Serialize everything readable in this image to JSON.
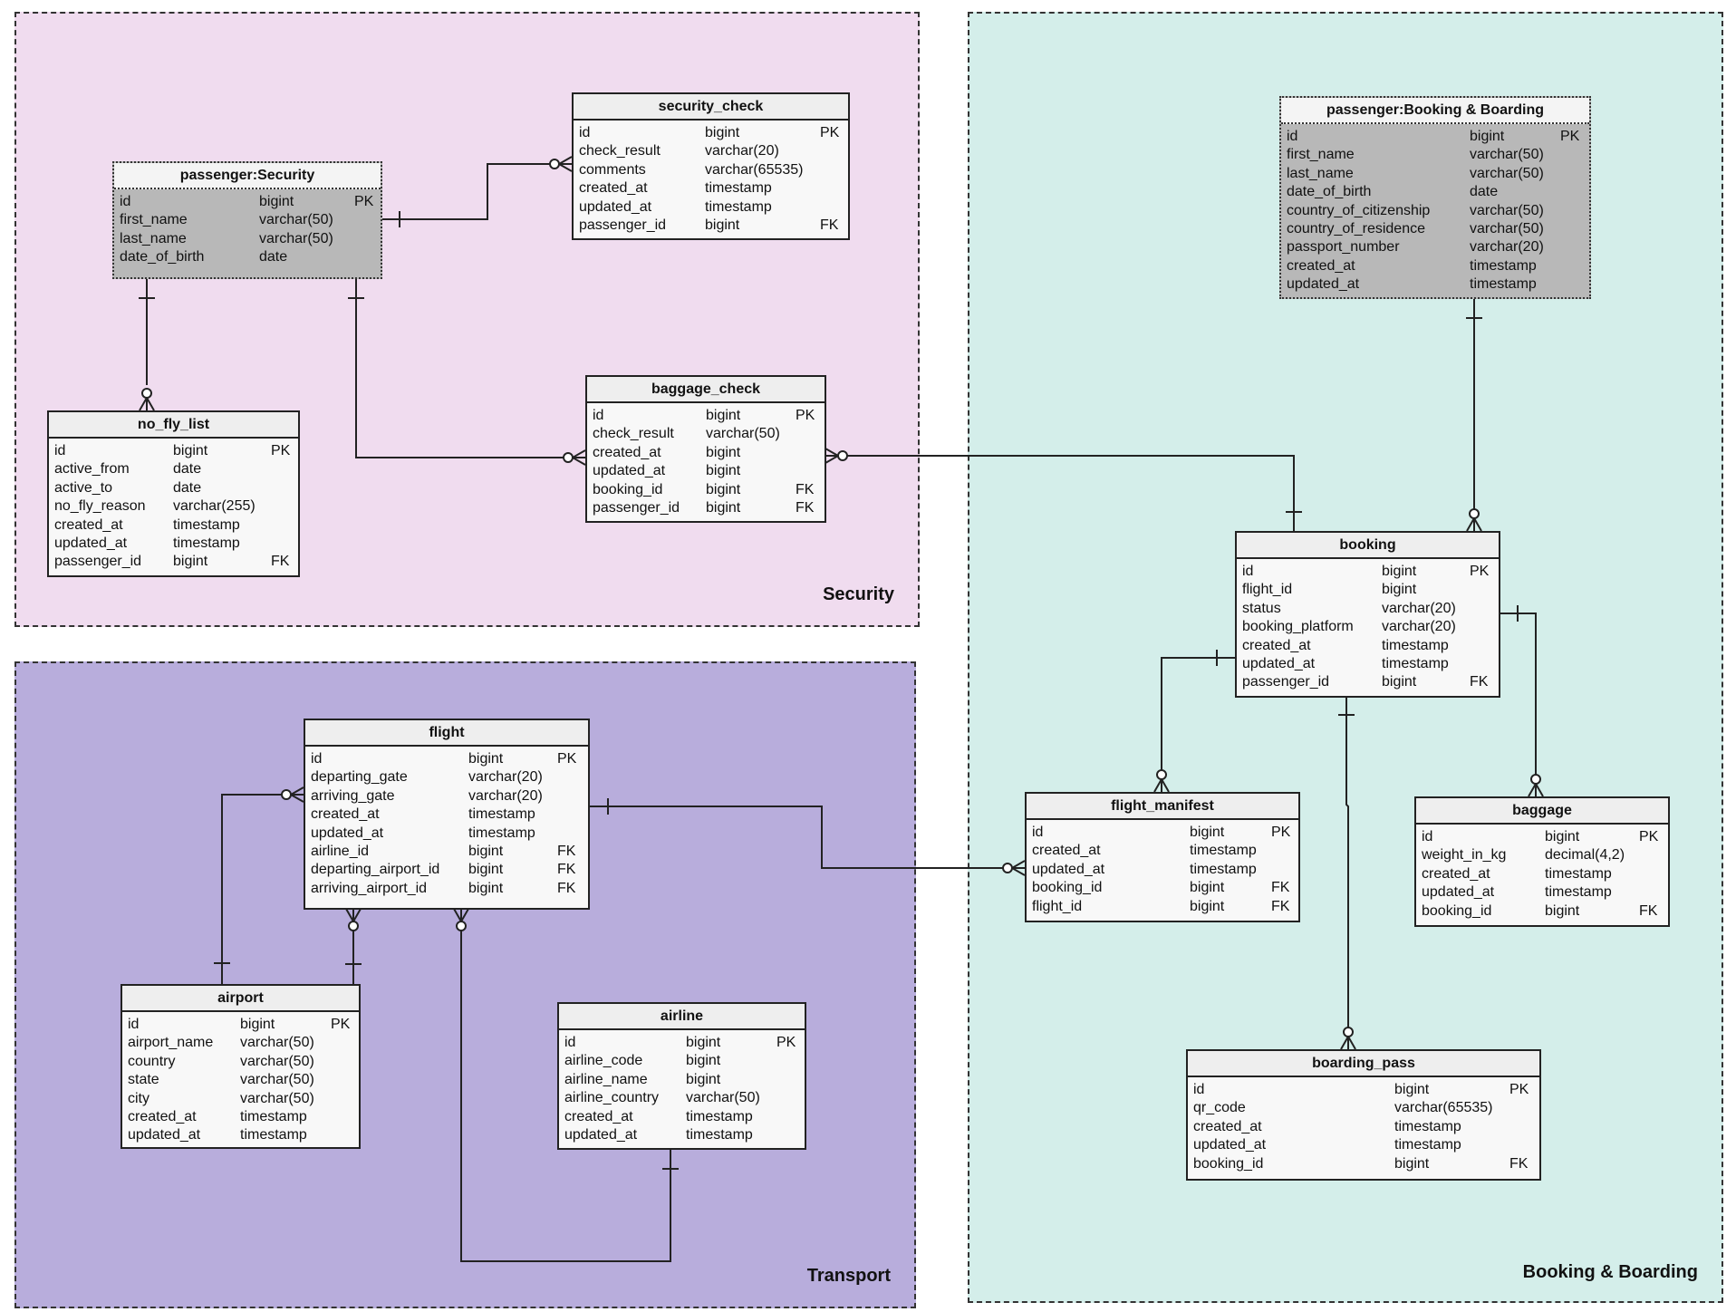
{
  "groups": {
    "security": {
      "label": "Security",
      "color": "#f0dcef"
    },
    "transport": {
      "label": "Transport",
      "color": "#b8addc"
    },
    "booking": {
      "label": "Booking & Boarding",
      "color": "#d4eeea"
    }
  },
  "tables": {
    "passenger_security": {
      "title": "passenger:Security",
      "columns": [
        [
          "id",
          "bigint",
          "PK"
        ],
        [
          "first_name",
          "varchar(50)",
          ""
        ],
        [
          "last_name",
          "varchar(50)",
          ""
        ],
        [
          "date_of_birth",
          "date",
          ""
        ]
      ]
    },
    "security_check": {
      "title": "security_check",
      "columns": [
        [
          "id",
          "bigint",
          "PK"
        ],
        [
          "check_result",
          "varchar(20)",
          ""
        ],
        [
          "comments",
          "varchar(65535)",
          ""
        ],
        [
          "created_at",
          "timestamp",
          ""
        ],
        [
          "updated_at",
          "timestamp",
          ""
        ],
        [
          "passenger_id",
          "bigint",
          "FK"
        ]
      ]
    },
    "no_fly_list": {
      "title": "no_fly_list",
      "columns": [
        [
          "id",
          "bigint",
          "PK"
        ],
        [
          "active_from",
          "date",
          ""
        ],
        [
          "active_to",
          "date",
          ""
        ],
        [
          "no_fly_reason",
          "varchar(255)",
          ""
        ],
        [
          "created_at",
          "timestamp",
          ""
        ],
        [
          "updated_at",
          "timestamp",
          ""
        ],
        [
          "passenger_id",
          "bigint",
          "FK"
        ]
      ]
    },
    "baggage_check": {
      "title": "baggage_check",
      "columns": [
        [
          "id",
          "bigint",
          "PK"
        ],
        [
          "check_result",
          "varchar(50)",
          ""
        ],
        [
          "created_at",
          "bigint",
          ""
        ],
        [
          "updated_at",
          "bigint",
          ""
        ],
        [
          "booking_id",
          "bigint",
          "FK"
        ],
        [
          "passenger_id",
          "bigint",
          "FK"
        ]
      ]
    },
    "passenger_booking": {
      "title": "passenger:Booking & Boarding",
      "columns": [
        [
          "id",
          "bigint",
          "PK"
        ],
        [
          "first_name",
          "varchar(50)",
          ""
        ],
        [
          "last_name",
          "varchar(50)",
          ""
        ],
        [
          "date_of_birth",
          "date",
          ""
        ],
        [
          "country_of_citizenship",
          "varchar(50)",
          ""
        ],
        [
          "country_of_residence",
          "varchar(50)",
          ""
        ],
        [
          "passport_number",
          "varchar(20)",
          ""
        ],
        [
          "created_at",
          "timestamp",
          ""
        ],
        [
          "updated_at",
          "timestamp",
          ""
        ]
      ]
    },
    "booking": {
      "title": "booking",
      "columns": [
        [
          "id",
          "bigint",
          "PK"
        ],
        [
          "flight_id",
          "bigint",
          ""
        ],
        [
          "status",
          "varchar(20)",
          ""
        ],
        [
          "booking_platform",
          "varchar(20)",
          ""
        ],
        [
          "created_at",
          "timestamp",
          ""
        ],
        [
          "updated_at",
          "timestamp",
          ""
        ],
        [
          "passenger_id",
          "bigint",
          "FK"
        ]
      ]
    },
    "flight_manifest": {
      "title": "flight_manifest",
      "columns": [
        [
          "id",
          "bigint",
          "PK"
        ],
        [
          "created_at",
          "timestamp",
          ""
        ],
        [
          "updated_at",
          "timestamp",
          ""
        ],
        [
          "booking_id",
          "bigint",
          "FK"
        ],
        [
          "flight_id",
          "bigint",
          "FK"
        ]
      ]
    },
    "baggage": {
      "title": "baggage",
      "columns": [
        [
          "id",
          "bigint",
          "PK"
        ],
        [
          "weight_in_kg",
          "decimal(4,2)",
          ""
        ],
        [
          "created_at",
          "timestamp",
          ""
        ],
        [
          "updated_at",
          "timestamp",
          ""
        ],
        [
          "booking_id",
          "bigint",
          "FK"
        ]
      ]
    },
    "boarding_pass": {
      "title": "boarding_pass",
      "columns": [
        [
          "id",
          "bigint",
          "PK"
        ],
        [
          "qr_code",
          "varchar(65535)",
          ""
        ],
        [
          "created_at",
          "timestamp",
          ""
        ],
        [
          "updated_at",
          "timestamp",
          ""
        ],
        [
          "booking_id",
          "bigint",
          "FK"
        ]
      ]
    },
    "flight": {
      "title": "flight",
      "columns": [
        [
          "id",
          "bigint",
          "PK"
        ],
        [
          "departing_gate",
          "varchar(20)",
          ""
        ],
        [
          "arriving_gate",
          "varchar(20)",
          ""
        ],
        [
          "created_at",
          "timestamp",
          ""
        ],
        [
          "updated_at",
          "timestamp",
          ""
        ],
        [
          "airline_id",
          "bigint",
          "FK"
        ],
        [
          "departing_airport_id",
          "bigint",
          "FK"
        ],
        [
          "arriving_airport_id",
          "bigint",
          "FK"
        ]
      ]
    },
    "airport": {
      "title": "airport",
      "columns": [
        [
          "id",
          "bigint",
          "PK"
        ],
        [
          "airport_name",
          "varchar(50)",
          ""
        ],
        [
          "country",
          "varchar(50)",
          ""
        ],
        [
          "state",
          "varchar(50)",
          ""
        ],
        [
          "city",
          "varchar(50)",
          ""
        ],
        [
          "created_at",
          "timestamp",
          ""
        ],
        [
          "updated_at",
          "timestamp",
          ""
        ]
      ]
    },
    "airline": {
      "title": "airline",
      "columns": [
        [
          "id",
          "bigint",
          "PK"
        ],
        [
          "airline_code",
          "bigint",
          ""
        ],
        [
          "airline_name",
          "bigint",
          ""
        ],
        [
          "airline_country",
          "varchar(50)",
          ""
        ],
        [
          "created_at",
          "timestamp",
          ""
        ],
        [
          "updated_at",
          "timestamp",
          ""
        ]
      ]
    }
  },
  "relationships": [
    {
      "from": "passenger_security",
      "to": "security_check",
      "from_card": "one",
      "to_card": "zero-or-many"
    },
    {
      "from": "passenger_security",
      "to": "no_fly_list",
      "from_card": "one",
      "to_card": "zero-or-many"
    },
    {
      "from": "passenger_security",
      "to": "baggage_check",
      "from_card": "one",
      "to_card": "zero-or-many"
    },
    {
      "from": "booking",
      "to": "baggage_check",
      "from_card": "one",
      "to_card": "zero-or-many"
    },
    {
      "from": "passenger_booking",
      "to": "booking",
      "from_card": "one",
      "to_card": "zero-or-many"
    },
    {
      "from": "booking",
      "to": "flight_manifest",
      "from_card": "one",
      "to_card": "zero-or-many"
    },
    {
      "from": "booking",
      "to": "baggage",
      "from_card": "one",
      "to_card": "zero-or-many"
    },
    {
      "from": "booking",
      "to": "boarding_pass",
      "from_card": "one",
      "to_card": "zero-or-many"
    },
    {
      "from": "flight",
      "to": "flight_manifest",
      "from_card": "one",
      "to_card": "zero-or-many"
    },
    {
      "from": "airport",
      "to": "flight",
      "from_card": "one",
      "to_card": "zero-or-many"
    },
    {
      "from": "airport",
      "to": "flight",
      "from_card": "one",
      "to_card": "zero-or-many"
    },
    {
      "from": "airline",
      "to": "flight",
      "from_card": "one",
      "to_card": "zero-or-many"
    }
  ]
}
